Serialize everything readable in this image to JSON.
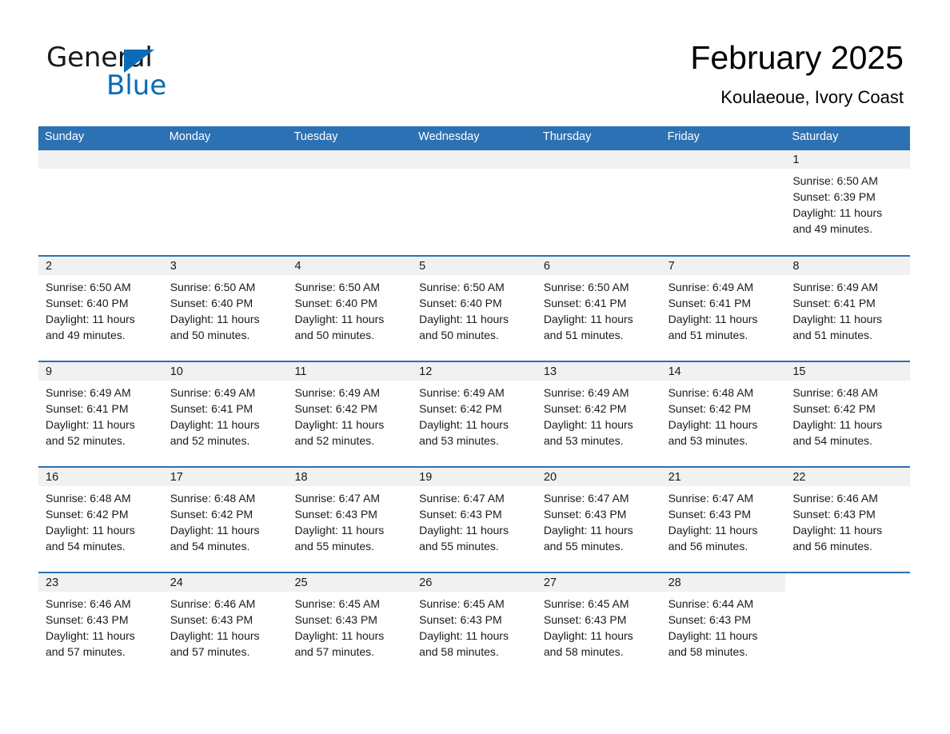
{
  "brand": {
    "name_part1": "General",
    "name_part2": "Blue",
    "triangle_color": "#0a6cb6"
  },
  "header": {
    "title": "February 2025",
    "subtitle": "Koulaeoue, Ivory Coast"
  },
  "colors": {
    "header_blue": "#2c71b3",
    "daynum_gray": "#f1f1f1",
    "text": "#1a1a1a"
  },
  "weekdays": [
    "Sunday",
    "Monday",
    "Tuesday",
    "Wednesday",
    "Thursday",
    "Friday",
    "Saturday"
  ],
  "weeks": [
    [
      {
        "day": "",
        "lines": []
      },
      {
        "day": "",
        "lines": []
      },
      {
        "day": "",
        "lines": []
      },
      {
        "day": "",
        "lines": []
      },
      {
        "day": "",
        "lines": []
      },
      {
        "day": "",
        "lines": []
      },
      {
        "day": "1",
        "lines": [
          "Sunrise: 6:50 AM",
          "Sunset: 6:39 PM",
          "Daylight: 11 hours",
          "and 49 minutes."
        ]
      }
    ],
    [
      {
        "day": "2",
        "lines": [
          "Sunrise: 6:50 AM",
          "Sunset: 6:40 PM",
          "Daylight: 11 hours",
          "and 49 minutes."
        ]
      },
      {
        "day": "3",
        "lines": [
          "Sunrise: 6:50 AM",
          "Sunset: 6:40 PM",
          "Daylight: 11 hours",
          "and 50 minutes."
        ]
      },
      {
        "day": "4",
        "lines": [
          "Sunrise: 6:50 AM",
          "Sunset: 6:40 PM",
          "Daylight: 11 hours",
          "and 50 minutes."
        ]
      },
      {
        "day": "5",
        "lines": [
          "Sunrise: 6:50 AM",
          "Sunset: 6:40 PM",
          "Daylight: 11 hours",
          "and 50 minutes."
        ]
      },
      {
        "day": "6",
        "lines": [
          "Sunrise: 6:50 AM",
          "Sunset: 6:41 PM",
          "Daylight: 11 hours",
          "and 51 minutes."
        ]
      },
      {
        "day": "7",
        "lines": [
          "Sunrise: 6:49 AM",
          "Sunset: 6:41 PM",
          "Daylight: 11 hours",
          "and 51 minutes."
        ]
      },
      {
        "day": "8",
        "lines": [
          "Sunrise: 6:49 AM",
          "Sunset: 6:41 PM",
          "Daylight: 11 hours",
          "and 51 minutes."
        ]
      }
    ],
    [
      {
        "day": "9",
        "lines": [
          "Sunrise: 6:49 AM",
          "Sunset: 6:41 PM",
          "Daylight: 11 hours",
          "and 52 minutes."
        ]
      },
      {
        "day": "10",
        "lines": [
          "Sunrise: 6:49 AM",
          "Sunset: 6:41 PM",
          "Daylight: 11 hours",
          "and 52 minutes."
        ]
      },
      {
        "day": "11",
        "lines": [
          "Sunrise: 6:49 AM",
          "Sunset: 6:42 PM",
          "Daylight: 11 hours",
          "and 52 minutes."
        ]
      },
      {
        "day": "12",
        "lines": [
          "Sunrise: 6:49 AM",
          "Sunset: 6:42 PM",
          "Daylight: 11 hours",
          "and 53 minutes."
        ]
      },
      {
        "day": "13",
        "lines": [
          "Sunrise: 6:49 AM",
          "Sunset: 6:42 PM",
          "Daylight: 11 hours",
          "and 53 minutes."
        ]
      },
      {
        "day": "14",
        "lines": [
          "Sunrise: 6:48 AM",
          "Sunset: 6:42 PM",
          "Daylight: 11 hours",
          "and 53 minutes."
        ]
      },
      {
        "day": "15",
        "lines": [
          "Sunrise: 6:48 AM",
          "Sunset: 6:42 PM",
          "Daylight: 11 hours",
          "and 54 minutes."
        ]
      }
    ],
    [
      {
        "day": "16",
        "lines": [
          "Sunrise: 6:48 AM",
          "Sunset: 6:42 PM",
          "Daylight: 11 hours",
          "and 54 minutes."
        ]
      },
      {
        "day": "17",
        "lines": [
          "Sunrise: 6:48 AM",
          "Sunset: 6:42 PM",
          "Daylight: 11 hours",
          "and 54 minutes."
        ]
      },
      {
        "day": "18",
        "lines": [
          "Sunrise: 6:47 AM",
          "Sunset: 6:43 PM",
          "Daylight: 11 hours",
          "and 55 minutes."
        ]
      },
      {
        "day": "19",
        "lines": [
          "Sunrise: 6:47 AM",
          "Sunset: 6:43 PM",
          "Daylight: 11 hours",
          "and 55 minutes."
        ]
      },
      {
        "day": "20",
        "lines": [
          "Sunrise: 6:47 AM",
          "Sunset: 6:43 PM",
          "Daylight: 11 hours",
          "and 55 minutes."
        ]
      },
      {
        "day": "21",
        "lines": [
          "Sunrise: 6:47 AM",
          "Sunset: 6:43 PM",
          "Daylight: 11 hours",
          "and 56 minutes."
        ]
      },
      {
        "day": "22",
        "lines": [
          "Sunrise: 6:46 AM",
          "Sunset: 6:43 PM",
          "Daylight: 11 hours",
          "and 56 minutes."
        ]
      }
    ],
    [
      {
        "day": "23",
        "lines": [
          "Sunrise: 6:46 AM",
          "Sunset: 6:43 PM",
          "Daylight: 11 hours",
          "and 57 minutes."
        ]
      },
      {
        "day": "24",
        "lines": [
          "Sunrise: 6:46 AM",
          "Sunset: 6:43 PM",
          "Daylight: 11 hours",
          "and 57 minutes."
        ]
      },
      {
        "day": "25",
        "lines": [
          "Sunrise: 6:45 AM",
          "Sunset: 6:43 PM",
          "Daylight: 11 hours",
          "and 57 minutes."
        ]
      },
      {
        "day": "26",
        "lines": [
          "Sunrise: 6:45 AM",
          "Sunset: 6:43 PM",
          "Daylight: 11 hours",
          "and 58 minutes."
        ]
      },
      {
        "day": "27",
        "lines": [
          "Sunrise: 6:45 AM",
          "Sunset: 6:43 PM",
          "Daylight: 11 hours",
          "and 58 minutes."
        ]
      },
      {
        "day": "28",
        "lines": [
          "Sunrise: 6:44 AM",
          "Sunset: 6:43 PM",
          "Daylight: 11 hours",
          "and 58 minutes."
        ]
      },
      {
        "day": "",
        "lines": []
      }
    ]
  ]
}
